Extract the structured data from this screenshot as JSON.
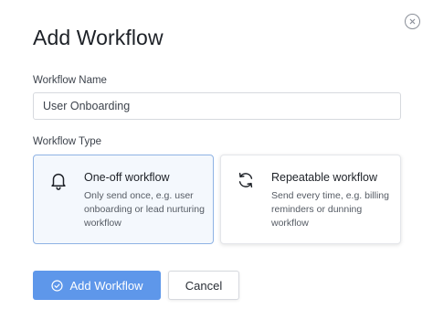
{
  "dialog": {
    "title": "Add Workflow",
    "close_icon": "close-circle-icon"
  },
  "form": {
    "name_label": "Workflow Name",
    "name_value": "User Onboarding",
    "type_label": "Workflow Type",
    "types": [
      {
        "title": "One-off workflow",
        "description": "Only send once, e.g. user onboarding or lead nurturing workflow",
        "icon": "bell-icon",
        "selected": true
      },
      {
        "title": "Repeatable workflow",
        "description": "Send every time, e.g. billing reminders or dunning workflow",
        "icon": "refresh-icon",
        "selected": false
      }
    ]
  },
  "actions": {
    "add_label": "Add Workflow",
    "add_icon": "check-circle-icon",
    "cancel_label": "Cancel"
  },
  "colors": {
    "primary": "#5e97ea",
    "selected_card_bg": "#f4f8fd",
    "selected_card_border": "#8fb3e4"
  }
}
